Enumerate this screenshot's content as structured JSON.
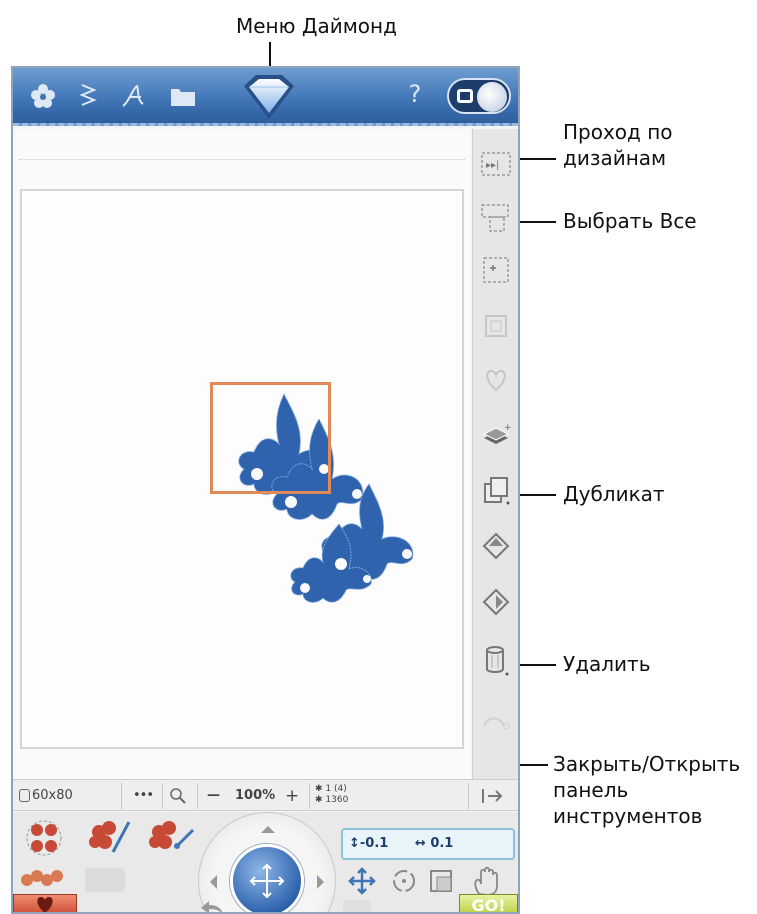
{
  "annotations": {
    "diamond_menu": "Меню Даймонд",
    "design_walk_line1": "Проход по",
    "design_walk_line2": "дизайнам",
    "select_all": "Выбрать Все",
    "duplicate": "Дубликат",
    "delete": "Удалить",
    "close_open_line1": "Закрыть/Открыть",
    "close_open_line2": "панель",
    "close_open_line3": "инструментов"
  },
  "topbar": {
    "icons": [
      "flower-icon",
      "stitch-icon",
      "font-icon",
      "folder-icon",
      "diamond-menu-icon",
      "help-icon",
      "mode-toggle-icon"
    ],
    "help_label": "?"
  },
  "status": {
    "hoop_size": "60x80",
    "dots": "•••",
    "zoom": "100%",
    "zoom_minus": "—",
    "zoom_plus": "+",
    "design_count": "1 (4)",
    "stitch_count": "1360"
  },
  "coords": {
    "vertical": "-0.1",
    "horizontal": "0.1"
  },
  "bottom": {
    "go_label": "GO!"
  },
  "colors": {
    "topbar": "#3f74b5",
    "design_blue": "#2f63ad",
    "selection": "#e08a5a",
    "go": "#b8cf3b",
    "heart": "#cc4b33"
  }
}
